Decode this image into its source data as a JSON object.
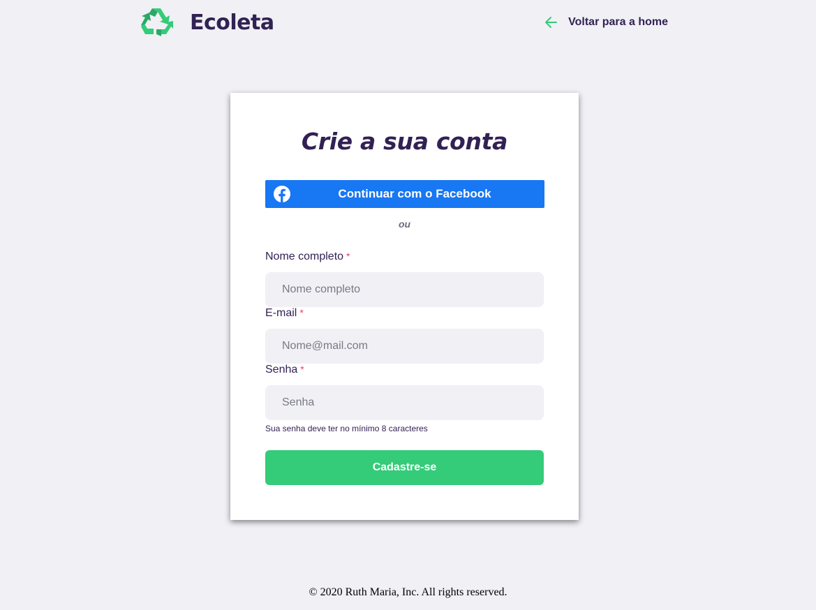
{
  "header": {
    "brand_name": "Ecoleta",
    "back_link_label": "Voltar para a home",
    "logo_icon": "recycle-icon",
    "back_icon": "arrow-left-icon"
  },
  "signup_card": {
    "title": "Crie a sua conta",
    "facebook_button_label": "Continuar com o Facebook",
    "facebook_icon": "facebook-icon",
    "divider_text": "ou",
    "fields": {
      "name": {
        "label": "Nome completo",
        "required_mark": "*",
        "placeholder": "Nome completo",
        "value": ""
      },
      "email": {
        "label": "E-mail",
        "required_mark": "*",
        "placeholder": "Nome@mail.com",
        "value": ""
      },
      "password": {
        "label": "Senha",
        "required_mark": "*",
        "placeholder": "Senha",
        "value": ""
      }
    },
    "password_hint": "Sua senha deve ter no mínimo 8 caracteres",
    "submit_label": "Cadastre-se"
  },
  "footer": {
    "copyright": "© 2020 Ruth Maria, Inc. All rights reserved."
  },
  "colors": {
    "background": "#f0f0f5",
    "brand_dark": "#322153",
    "accent_green": "#34cb79",
    "facebook_blue": "#1877f2",
    "required_red": "#e83f5b"
  }
}
